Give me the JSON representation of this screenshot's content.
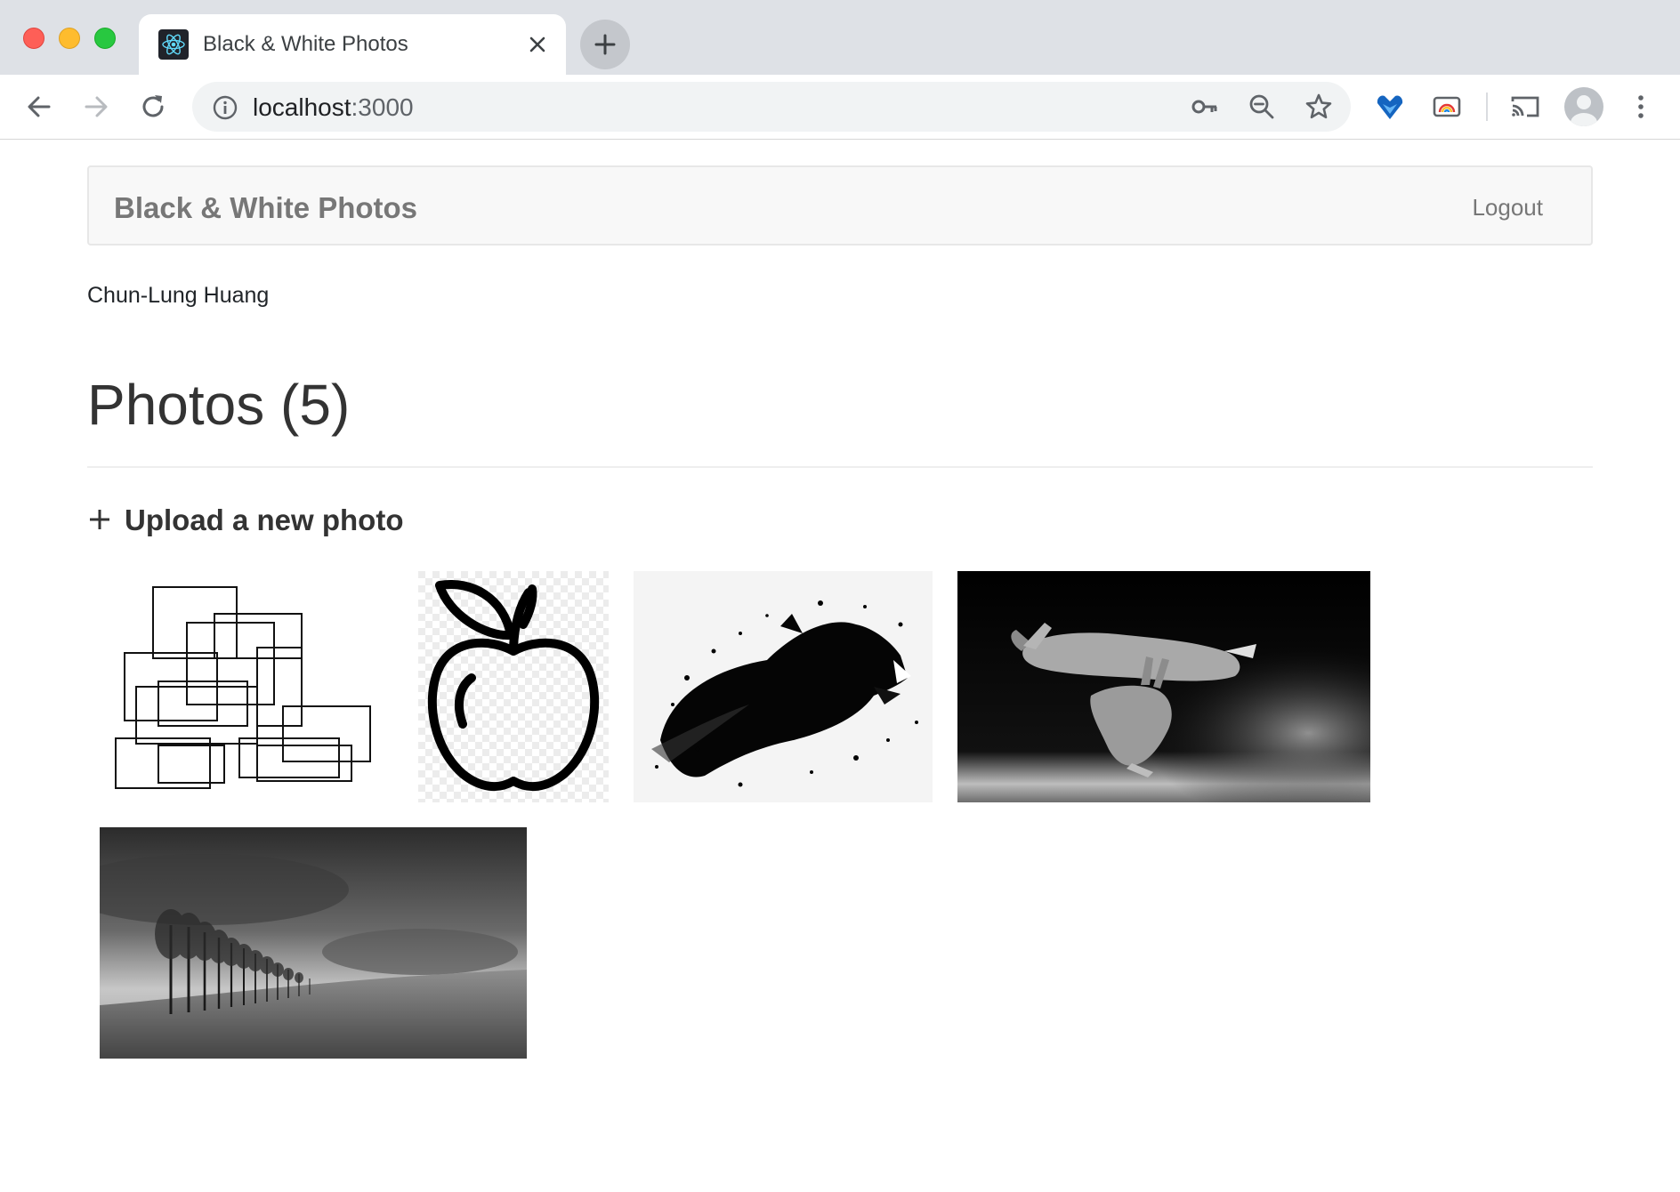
{
  "browser": {
    "tab_title": "Black & White Photos",
    "url_host": "localhost",
    "url_port": ":3000"
  },
  "navbar": {
    "brand": "Black & White Photos",
    "logout_label": "Logout"
  },
  "user": {
    "name": "Chun-Lung Huang"
  },
  "main": {
    "heading": "Photos (5)",
    "upload_label": "Upload a new photo"
  },
  "photos": [
    {
      "subject": "overlapping rectangles line drawing"
    },
    {
      "subject": "apple outline"
    },
    {
      "subject": "ink splash panther"
    },
    {
      "subject": "two leaping hares"
    },
    {
      "subject": "row of bare trees in a field"
    }
  ]
}
